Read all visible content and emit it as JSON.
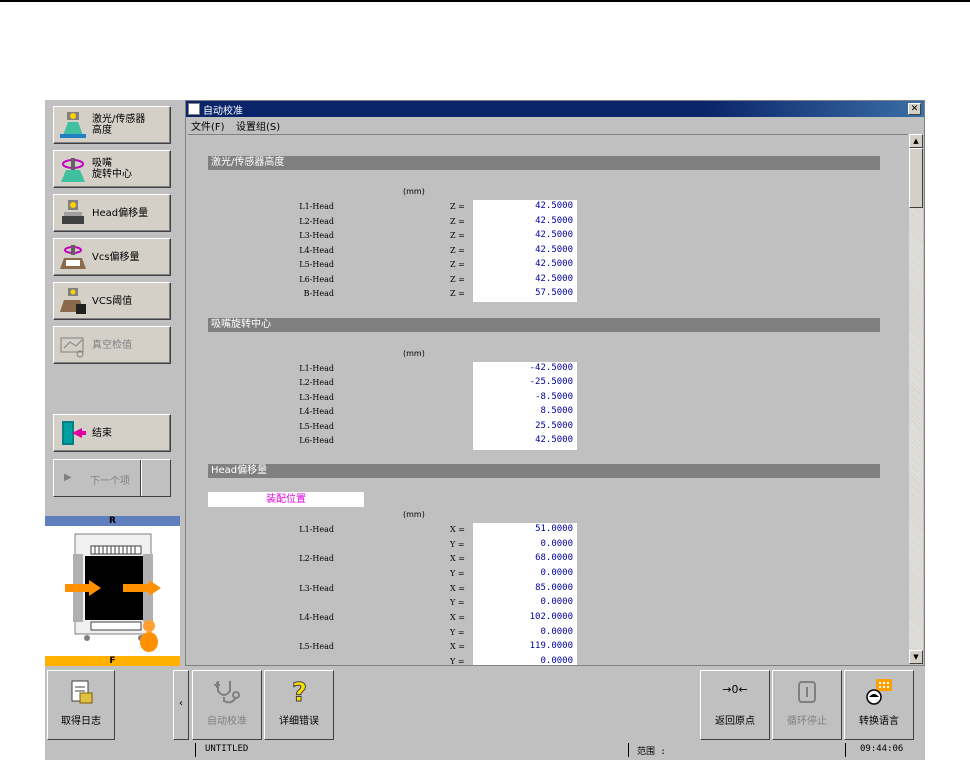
{
  "left_panel": {
    "buttons": [
      {
        "label_line1": "激光/传感器",
        "label_line2": "高度",
        "icon": "laser-sensor-icon",
        "enabled": true
      },
      {
        "label_line1": "吸嘴",
        "label_line2": "旋转中心",
        "icon": "nozzle-rotation-icon",
        "enabled": true
      },
      {
        "label_line1": "Head偏移量",
        "label_line2": "",
        "icon": "head-offset-icon",
        "enabled": true
      },
      {
        "label_line1": "Vcs偏移量",
        "label_line2": "",
        "icon": "vcs-offset-icon",
        "enabled": true
      },
      {
        "label_line1": "VCS阈值",
        "label_line2": "",
        "icon": "vcs-threshold-icon",
        "enabled": true
      },
      {
        "label_line1": "真空检值",
        "label_line2": "",
        "icon": "vacuum-check-icon",
        "enabled": false
      }
    ],
    "finish_label": "结束",
    "next_label": "下一个项",
    "board_top_label": "R",
    "board_bottom_label": "F"
  },
  "window": {
    "title": "自动校准",
    "close_glyph": "✕",
    "menu": [
      "文件(F)",
      "设置组(S)"
    ]
  },
  "sections": {
    "laser": {
      "title": "激光/传感器高度",
      "unit": "(mm)",
      "axis": "Z =",
      "rows": [
        {
          "label": "L1-Head",
          "value": "42.5000"
        },
        {
          "label": "L2-Head",
          "value": "42.5000"
        },
        {
          "label": "L3-Head",
          "value": "42.5000"
        },
        {
          "label": "L4-Head",
          "value": "42.5000"
        },
        {
          "label": "L5-Head",
          "value": "42.5000"
        },
        {
          "label": "L6-Head",
          "value": "42.5000"
        },
        {
          "label": "B-Head",
          "value": "57.5000"
        }
      ]
    },
    "nozzle": {
      "title": "吸嘴旋转中心",
      "unit": "(mm)",
      "rows": [
        {
          "label": "L1-Head",
          "value": "-42.5000"
        },
        {
          "label": "L2-Head",
          "value": "-25.5000"
        },
        {
          "label": "L3-Head",
          "value": "-8.5000"
        },
        {
          "label": "L4-Head",
          "value": "8.5000"
        },
        {
          "label": "L5-Head",
          "value": "25.5000"
        },
        {
          "label": "L6-Head",
          "value": "42.5000"
        }
      ]
    },
    "head_offset": {
      "title": "Head偏移量",
      "position_label": "装配位置",
      "unit": "(mm)",
      "x_axis": "X =",
      "y_axis": "Y =",
      "rows": [
        {
          "label": "L1-Head",
          "x": "51.0000",
          "y": "0.0000"
        },
        {
          "label": "L2-Head",
          "x": "68.0000",
          "y": "0.0000"
        },
        {
          "label": "L3-Head",
          "x": "85.0000",
          "y": "0.0000"
        },
        {
          "label": "L4-Head",
          "x": "102.0000",
          "y": "0.0000"
        },
        {
          "label": "L5-Head",
          "x": "119.0000",
          "y": "0.0000"
        }
      ]
    }
  },
  "toolbar": {
    "get_log": "取得日志",
    "collapse_glyph": "‹",
    "auto_check": "自动校准",
    "error_detail": "详细错误",
    "return_origin": "返回原点",
    "cycle_stop": "循环停止",
    "switch_language": "转换语言",
    "return_origin_glyph": "→0←"
  },
  "status": {
    "file": "UNTITLED",
    "range_label": "范围 :",
    "time": "09:44:06"
  },
  "colors": {
    "titlebar": "#0a246a",
    "section_header": "#808080",
    "value_text": "#0000a0",
    "position_text": "#e000e0",
    "board_top": "#5f7fbf",
    "board_bottom": "#ffb000"
  }
}
